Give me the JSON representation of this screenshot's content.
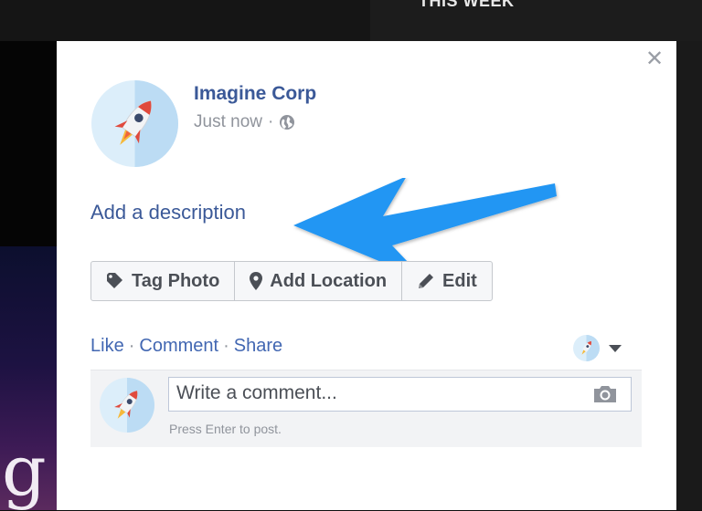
{
  "background": {
    "top_text": "THIS WEEK",
    "left_letter": "g"
  },
  "post": {
    "author": "Imagine Corp",
    "time": "Just now",
    "separator": "·",
    "privacy_icon": "globe-icon",
    "description_prompt": "Add a description"
  },
  "toolbar": {
    "tag_photo": "Tag Photo",
    "add_location": "Add Location",
    "edit": "Edit"
  },
  "actions": {
    "like": "Like",
    "comment": "Comment",
    "share": "Share",
    "sep": "·"
  },
  "comment": {
    "placeholder": "Write a comment...",
    "hint": "Press Enter to post."
  },
  "colors": {
    "link": "#3b5998",
    "action_link": "#4267b2",
    "annotation_arrow": "#2196f3",
    "avatar_bg": "#dceefa"
  }
}
